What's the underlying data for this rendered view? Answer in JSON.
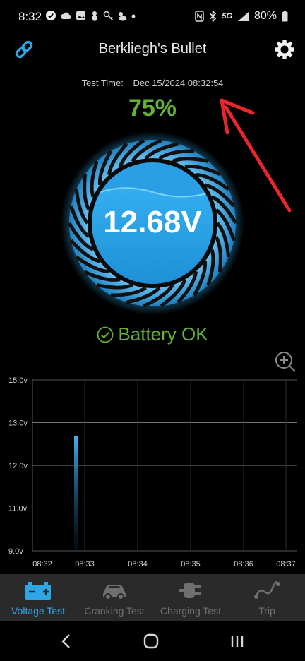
{
  "status_bar": {
    "time": "8:32",
    "battery": "80%",
    "network": "5G"
  },
  "header": {
    "title": "Berkliegh's Bullet",
    "icons": {
      "left": "link-icon",
      "right": "gear-icon"
    }
  },
  "test_time": {
    "label": "Test Time:",
    "value": "Dec 15/2024 08:32:54"
  },
  "charge_percent": "75%",
  "voltage": "12.68V",
  "status": {
    "text": "Battery OK",
    "icon": "check-circle-icon"
  },
  "zoom_icon": "zoom-in-icon",
  "colors": {
    "accent_blue": "#2fa6e4",
    "ok_green": "#64b234",
    "annotation_red": "#e8262b",
    "nav_bg": "#2a2a2a"
  },
  "chart_data": {
    "type": "bar",
    "y_ticks": [
      "15.0v",
      "13.0v",
      "12.0v",
      "11.0v",
      "9.0v"
    ],
    "x_ticks": [
      "08:32",
      "08:33",
      "08:34",
      "08:35",
      "08:36",
      "08:37"
    ],
    "bars": [
      {
        "x": "08:32:54",
        "value": 12.68
      }
    ]
  },
  "bottom_nav": [
    {
      "label": "Voltage Test",
      "icon": "battery-icon",
      "active": true
    },
    {
      "label": "Cranking Test",
      "icon": "car-icon",
      "active": false
    },
    {
      "label": "Charging Test",
      "icon": "plug-icon",
      "active": false
    },
    {
      "label": "Trip",
      "icon": "route-icon",
      "active": false
    }
  ],
  "system_nav": [
    "back-icon",
    "home-icon",
    "recents-icon"
  ]
}
